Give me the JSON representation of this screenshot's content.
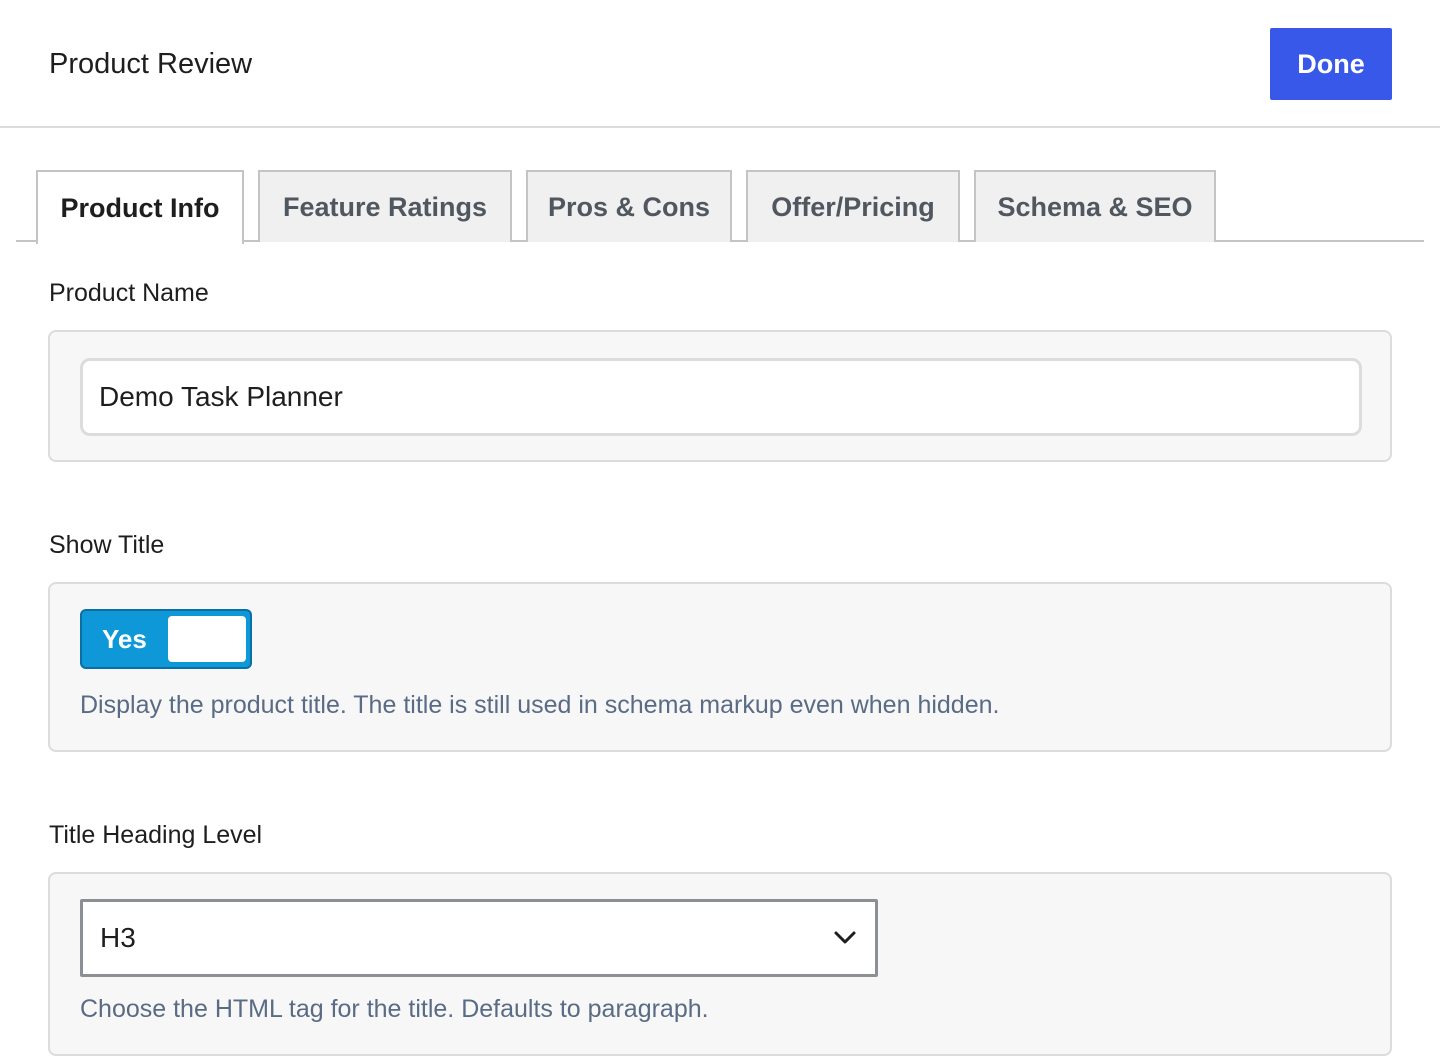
{
  "header": {
    "title": "Product Review",
    "done_label": "Done"
  },
  "tabs": [
    {
      "label": "Product Info",
      "active": true
    },
    {
      "label": "Feature Ratings",
      "active": false
    },
    {
      "label": "Pros & Cons",
      "active": false
    },
    {
      "label": "Offer/Pricing",
      "active": false
    },
    {
      "label": "Schema & SEO",
      "active": false
    }
  ],
  "product_name": {
    "label": "Product Name",
    "value": "Demo Task Planner"
  },
  "show_title": {
    "label": "Show Title",
    "toggle_label": "Yes",
    "enabled": true,
    "help": "Display the product title. The title is still used in schema markup even when hidden."
  },
  "heading_level": {
    "label": "Title Heading Level",
    "selected": "H3",
    "help": "Choose the HTML tag for the title. Defaults to paragraph."
  },
  "colors": {
    "primary": "#3858e9",
    "toggle": "#0f98d8",
    "help_text": "#5a6b85"
  }
}
